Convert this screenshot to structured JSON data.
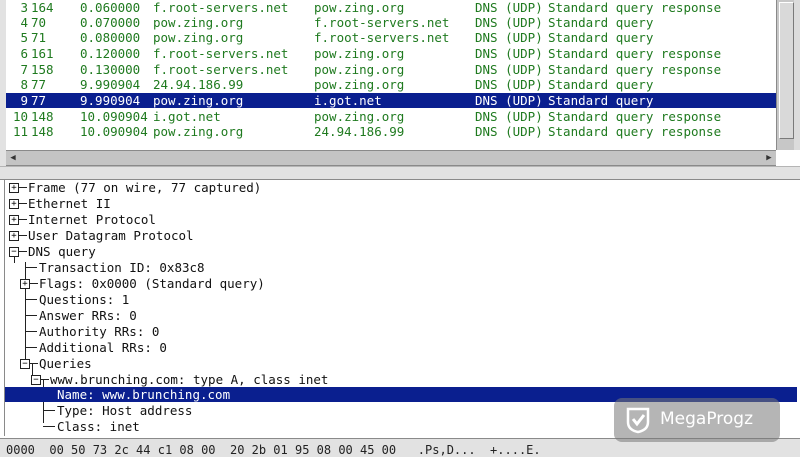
{
  "packet_list": {
    "rows": [
      {
        "no": "3",
        "len": "164",
        "time": "0.060000",
        "src": "f.root-servers.net",
        "dst": "pow.zing.org",
        "proto": "DNS (UDP)",
        "info": "Standard query response",
        "selected": false
      },
      {
        "no": "4",
        "len": "70",
        "time": "0.070000",
        "src": "pow.zing.org",
        "dst": "f.root-servers.net",
        "proto": "DNS (UDP)",
        "info": "Standard query",
        "selected": false
      },
      {
        "no": "5",
        "len": "71",
        "time": "0.080000",
        "src": "pow.zing.org",
        "dst": "f.root-servers.net",
        "proto": "DNS (UDP)",
        "info": "Standard query",
        "selected": false
      },
      {
        "no": "6",
        "len": "161",
        "time": "0.120000",
        "src": "f.root-servers.net",
        "dst": "pow.zing.org",
        "proto": "DNS (UDP)",
        "info": "Standard query response",
        "selected": false
      },
      {
        "no": "7",
        "len": "158",
        "time": "0.130000",
        "src": "f.root-servers.net",
        "dst": "pow.zing.org",
        "proto": "DNS (UDP)",
        "info": "Standard query response",
        "selected": false
      },
      {
        "no": "8",
        "len": "77",
        "time": "9.990904",
        "src": "24.94.186.99",
        "dst": "pow.zing.org",
        "proto": "DNS (UDP)",
        "info": "Standard query",
        "selected": false
      },
      {
        "no": "9",
        "len": "77",
        "time": "9.990904",
        "src": "pow.zing.org",
        "dst": "i.got.net",
        "proto": "DNS (UDP)",
        "info": "Standard query",
        "selected": true
      },
      {
        "no": "10",
        "len": "148",
        "time": "10.090904",
        "src": "i.got.net",
        "dst": "pow.zing.org",
        "proto": "DNS (UDP)",
        "info": "Standard query response",
        "selected": false
      },
      {
        "no": "11",
        "len": "148",
        "time": "10.090904",
        "src": "pow.zing.org",
        "dst": "24.94.186.99",
        "proto": "DNS (UDP)",
        "info": "Standard query response",
        "selected": false
      }
    ]
  },
  "detail_tree": {
    "frame": "Frame (77 on wire, 77 captured)",
    "ethernet": "Ethernet II",
    "ip": "Internet Protocol",
    "udp": "User Datagram Protocol",
    "dns": "DNS query",
    "transaction_id": "Transaction ID: 0x83c8",
    "flags": "Flags: 0x0000 (Standard query)",
    "questions": "Questions: 1",
    "answer_rrs": "Answer RRs: 0",
    "authority_rrs": "Authority RRs: 0",
    "additional_rrs": "Additional RRs: 0",
    "queries": "Queries",
    "query": "www.brunching.com: type A, class inet",
    "name": "Name: www.brunching.com",
    "type": "Type: Host address",
    "class": "Class: inet"
  },
  "hex_pane": {
    "line": "0000  00 50 73 2c 44 c1 08 00  20 2b 01 95 08 00 45 00   .Ps,D...  +....E."
  },
  "watermark": {
    "text": "MegaProgz"
  },
  "colors": {
    "list_text": "#1f7a1f",
    "selection": "#0a1f8f"
  },
  "icons": {
    "expand": "plus-box-icon",
    "collapse": "minus-box-icon",
    "watermark_logo": "check-shield-icon"
  }
}
